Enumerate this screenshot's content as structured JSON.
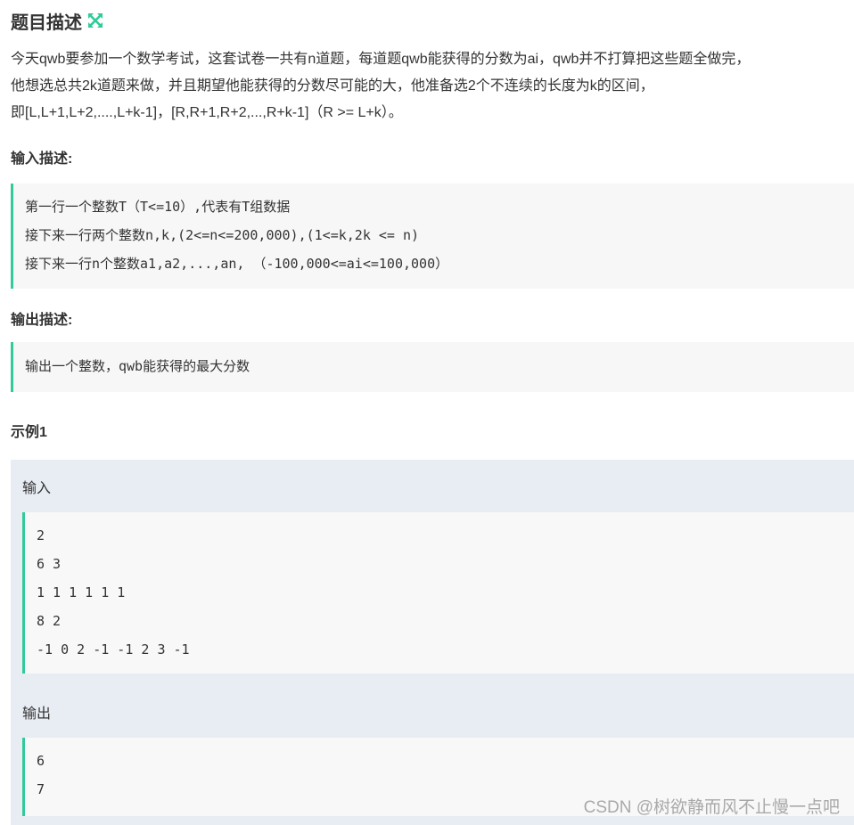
{
  "header": {
    "title": "题目描述",
    "icon": "expand-arrows-icon",
    "icon_color": "#32ca99"
  },
  "description": {
    "lines": [
      "今天qwb要参加一个数学考试，这套试卷一共有n道题，每道题qwb能获得的分数为ai，qwb并不打算把这些题全做完，",
      "他想选总共2k道题来做，并且期望他能获得的分数尽可能的大，他准备选2个不连续的长度为k的区间，",
      "即[L,L+1,L+2,....,L+k-1]，[R,R+1,R+2,...,R+k-1]（R >= L+k）。"
    ]
  },
  "input_section": {
    "heading": "输入描述:",
    "lines": [
      "第一行一个整数T（T<=10）,代表有T组数据",
      "接下来一行两个整数n,k,(2<=n<=200,000),(1<=k,2k <= n)",
      "接下来一行n个整数a1,a2,...,an, （-100,000<=ai<=100,000）"
    ]
  },
  "output_section": {
    "heading": "输出描述:",
    "lines": [
      "输出一个整数，qwb能获得的最大分数"
    ]
  },
  "example": {
    "heading": "示例1",
    "input_label": "输入",
    "input_lines": [
      "2",
      "6 3",
      "1 1 1 1 1 1",
      "8 2",
      "-1 0 2 -1 -1 2 3 -1"
    ],
    "output_label": "输出",
    "output_lines": [
      "6",
      "7"
    ]
  },
  "watermark": "CSDN @树欲静而风不止慢一点吧",
  "colors": {
    "accent": "#32ca99",
    "quote_bg": "#f7f7f7",
    "example_bg": "#e8edf4"
  }
}
